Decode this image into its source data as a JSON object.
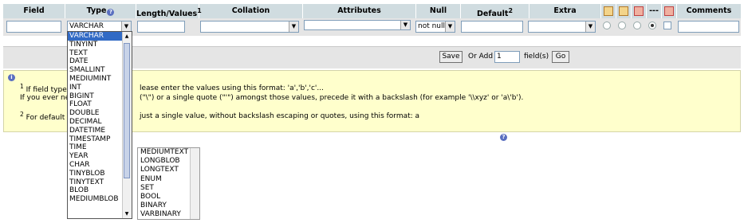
{
  "header": {
    "field": "Field",
    "type": "Type",
    "length_values": "Length/Values",
    "length_sup": "1",
    "collation": "Collation",
    "attributes": "Attributes",
    "null": "Null",
    "default": "Default",
    "default_sup": "2",
    "extra": "Extra",
    "dashes": "---",
    "comments": "Comments"
  },
  "row": {
    "type_value": "VARCHAR",
    "null_value": "not null"
  },
  "save_bar": {
    "save_label": "Save",
    "or_add": "Or Add",
    "count": "1",
    "fields_label": "field(s)",
    "go_label": "Go"
  },
  "notes": {
    "line1_sup": "1",
    "line1": "If field type is \"enum\" or \"set\", please enter the values using this format: 'a','b','c'...",
    "line1_visible": "lease enter the values using this format: 'a','b','c'...",
    "line1_prefix": "If field type i",
    "line2_prefix": "If you ever nee",
    "line2_visible": "(\"\\\") or a single quote (\"'\") amongst those values, precede it with a backslash (for example '\\\\xyz' or 'a\\'b').",
    "line3_sup": "2",
    "line3_prefix": "For default v",
    "line3_visible": "just a single value, without backslash escaping or quotes, using this format: a"
  },
  "type_options": [
    "VARCHAR",
    "TINYINT",
    "TEXT",
    "DATE",
    "SMALLINT",
    "MEDIUMINT",
    "INT",
    "BIGINT",
    "FLOAT",
    "DOUBLE",
    "DECIMAL",
    "DATETIME",
    "TIMESTAMP",
    "TIME",
    "YEAR",
    "CHAR",
    "TINYBLOB",
    "TINYTEXT",
    "BLOB",
    "MEDIUMBLOB"
  ],
  "type_options_2": [
    "MEDIUMTEXT",
    "LONGBLOB",
    "LONGTEXT",
    "ENUM",
    "SET",
    "BOOL",
    "BINARY",
    "VARBINARY"
  ],
  "colors": {
    "header_bg": "#d0dce0",
    "selection": "#316ac5",
    "note_bg": "#ffffcc"
  },
  "icons": [
    "help-icon",
    "primary-key-icon",
    "index-icon",
    "unique-icon",
    "fulltext-icon"
  ]
}
